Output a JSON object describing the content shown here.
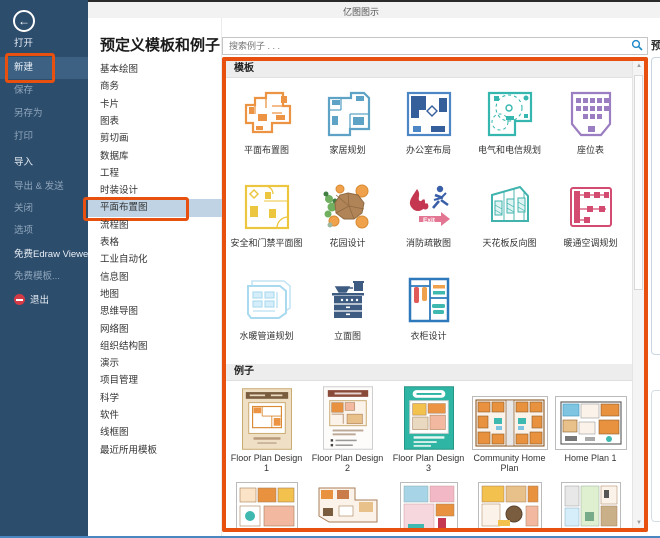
{
  "window": {
    "title": "亿图图示"
  },
  "sidebar": {
    "back_icon": "←",
    "items": [
      {
        "label": "打开"
      },
      {
        "label": "新建",
        "selected": true,
        "annotated": true
      },
      {
        "label": "保存",
        "dim": true
      },
      {
        "label": "另存为",
        "dim": true
      },
      {
        "label": "打印",
        "dim": true
      },
      {
        "label": "导入"
      },
      {
        "label": "导出 & 发送",
        "dim": true
      },
      {
        "label": "关闭",
        "dim": true
      },
      {
        "label": "选项",
        "dim": true
      },
      {
        "label": "免费Edraw Viewer"
      },
      {
        "label": "免费模板...",
        "dim": true
      },
      {
        "label": "退出",
        "icon": "exit"
      }
    ]
  },
  "categories": {
    "header": "预定义模板和例子",
    "selected": "平面布置图",
    "items": [
      "基本绘图",
      "商务",
      "卡片",
      "图表",
      "剪切画",
      "数据库",
      "工程",
      "时装设计",
      "平面布置图",
      "流程图",
      "表格",
      "工业自动化",
      "信息图",
      "地图",
      "思维导图",
      "网络图",
      "组织结构图",
      "演示",
      "项目管理",
      "科学",
      "软件",
      "线框图",
      "最近所用模板"
    ]
  },
  "search": {
    "placeholder": "搜索例子 . . ."
  },
  "panel": {
    "templates_header": "模板",
    "examples_header": "例子",
    "templates": [
      {
        "label": "平面布置图",
        "icon": "floor-plan-icon",
        "color": "#EC9443"
      },
      {
        "label": "家居规划",
        "icon": "home-plan-icon",
        "color": "#5EA3C6"
      },
      {
        "label": "办公室布局",
        "icon": "office-layout-icon",
        "color": "#4D86C4"
      },
      {
        "label": "电气和电信规划",
        "icon": "electrical-telecom-icon",
        "color": "#35B7B0"
      },
      {
        "label": "座位表",
        "icon": "seating-chart-icon",
        "color": "#9B7EC1"
      },
      {
        "label": "安全和门禁平面图",
        "icon": "security-access-icon",
        "color": "#EDC63F"
      },
      {
        "label": "花园设计",
        "icon": "garden-design-icon",
        "color": "#B08457"
      },
      {
        "label": "消防疏散图",
        "icon": "fire-escape-icon",
        "color": "#C53750"
      },
      {
        "label": "天花板反向图",
        "icon": "reflected-ceiling-icon",
        "color": "#3FB3AC"
      },
      {
        "label": "暖通空调规划",
        "icon": "hvac-plan-icon",
        "color": "#D34B70"
      },
      {
        "label": "水暖管道规划",
        "icon": "plumbing-piping-icon",
        "color": "#A9DAEF"
      },
      {
        "label": "立面图",
        "icon": "elevation-icon",
        "color": "#3E5C82"
      },
      {
        "label": "衣柜设计",
        "icon": "wardrobe-design-icon",
        "color": "#2E79BC"
      }
    ],
    "examples": [
      {
        "label": "Floor Plan Design 1"
      },
      {
        "label": "Floor Plan Design 2"
      },
      {
        "label": "Floor Plan Design 3"
      },
      {
        "label": "Community Home Plan"
      },
      {
        "label": "Home Plan 1"
      }
    ]
  },
  "preview": {
    "partial_title": "预"
  },
  "colors": {
    "annotation_orange": "#E8500F",
    "sidebar_blue": "#2D4D6D",
    "sidebar_selected": "#3D6183",
    "category_selected": "#BFD3E4",
    "search_icon_blue": "#1E88C7",
    "window_bottom_line": "#4A86C0"
  }
}
